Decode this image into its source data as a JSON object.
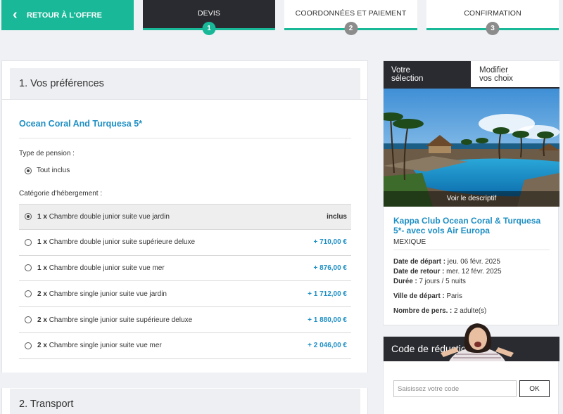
{
  "topbar": {
    "back_label": "RETOUR À L'OFFRE",
    "steps": [
      {
        "label": "DEVIS",
        "number": "1",
        "active": true
      },
      {
        "label": "COORDONNÉES ET PAIEMENT",
        "number": "2",
        "active": false
      },
      {
        "label": "CONFIRMATION",
        "number": "3",
        "active": false
      }
    ]
  },
  "preferences": {
    "section_title": "1. Vos préférences",
    "hotel_name": "Ocean Coral And Turquesa 5*",
    "pension_label": "Type de pension :",
    "pension_option": "Tout inclus",
    "category_label": "Catégorie d'hébergement :",
    "rooms": [
      {
        "qty": "1 x",
        "name": "Chambre double junior suite vue jardin",
        "price": "inclus",
        "selected": true
      },
      {
        "qty": "1 x",
        "name": "Chambre double junior suite supérieure deluxe",
        "price": "+ 710,00 €",
        "selected": false
      },
      {
        "qty": "1 x",
        "name": "Chambre double junior suite vue mer",
        "price": "+ 876,00 €",
        "selected": false
      },
      {
        "qty": "2 x",
        "name": "Chambre single junior suite vue jardin",
        "price": "+ 1 712,00 €",
        "selected": false
      },
      {
        "qty": "2 x",
        "name": "Chambre single junior suite supérieure deluxe",
        "price": "+ 1 880,00 €",
        "selected": false
      },
      {
        "qty": "2 x",
        "name": "Chambre single junior suite vue mer",
        "price": "+ 2 046,00 €",
        "selected": false
      }
    ]
  },
  "transport": {
    "section_title": "2. Transport"
  },
  "selection": {
    "tab_active_line1": "Votre",
    "tab_active_line2": "sélection",
    "tab_other_line1": "Modifier",
    "tab_other_line2": "vos choix",
    "see_description": "Voir le descriptif",
    "trip_title": "Kappa Club Ocean Coral & Turquesa 5*- avec vols Air Europa",
    "country": "MEXIQUE",
    "departure_label": "Date de départ :",
    "departure_value": "jeu. 06 févr. 2025",
    "return_label": "Date de retour :",
    "return_value": "mer. 12 févr. 2025",
    "duration_label": "Durée :",
    "duration_value": "7 jours / 5 nuits",
    "city_label": "Ville de départ :",
    "city_value": "Paris",
    "persons_label": "Nombre de pers. :",
    "persons_value": "2 adulte(s)"
  },
  "promo": {
    "title": "Code de réduction",
    "placeholder": "Saisissez votre code",
    "button": "OK"
  },
  "colors": {
    "accent": "#18b898",
    "dark": "#2a2b30",
    "link": "#1e8fc4"
  },
  "icons": {
    "back": "chevron-left-icon"
  }
}
